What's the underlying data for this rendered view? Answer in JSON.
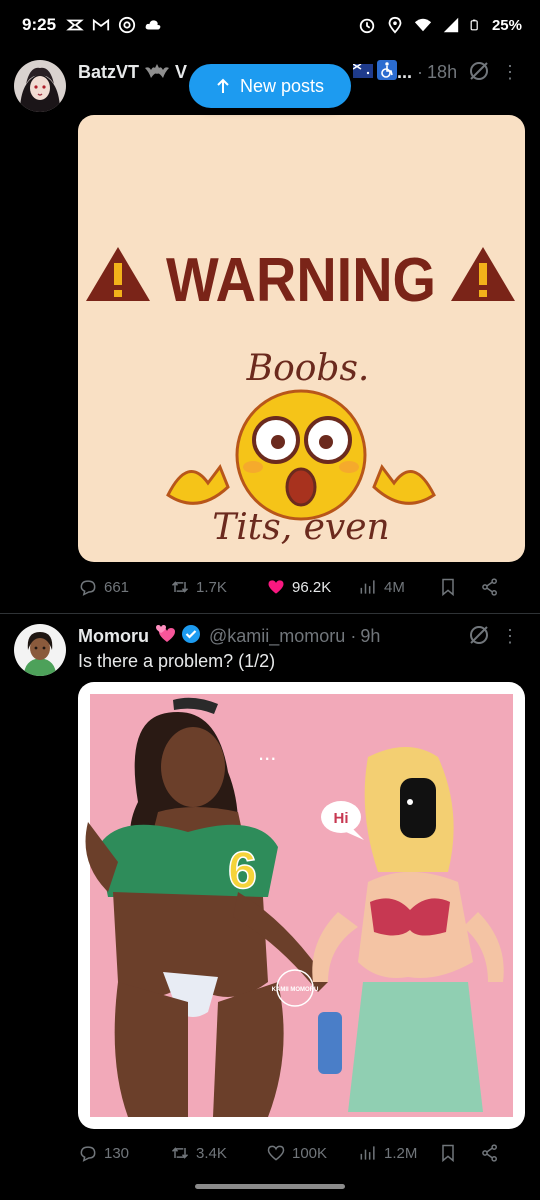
{
  "status_bar": {
    "time": "9:25",
    "battery": "25%"
  },
  "new_posts_label": "New posts",
  "tweets": [
    {
      "name": "BatzVT",
      "name_suffix": "V",
      "name_trailing": "...",
      "time": "18h",
      "text": "",
      "media": {
        "warning_title": "WARNING",
        "line1": "Boobs.",
        "line2": "Tits, even"
      },
      "stats": {
        "replies": "661",
        "reposts": "1.7K",
        "likes": "96.2K",
        "views": "4M"
      },
      "liked": true
    },
    {
      "name": "Momoru",
      "handle": "@kamii_momoru",
      "time": "9h",
      "text": "Is there a problem? (1/2)",
      "media": {
        "bubble_text": "Hi",
        "dots": "...",
        "jersey_number": "6",
        "watermark": "KAMII MOMORU"
      },
      "stats": {
        "replies": "130",
        "reposts": "3.4K",
        "likes": "100K",
        "views": "1.2M"
      },
      "liked": false
    }
  ],
  "colors": {
    "accent": "#1d9bf0",
    "like": "#f91880",
    "muted": "#71767b",
    "warning_bg": "#f9e0c4",
    "warning_text": "#7a2418",
    "art_bg": "#f2a9b9"
  }
}
